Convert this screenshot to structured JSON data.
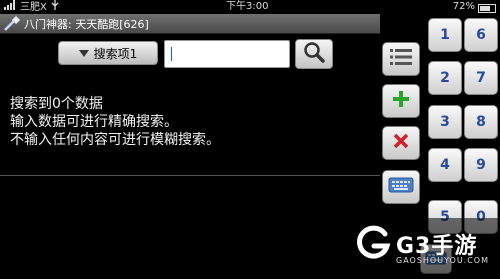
{
  "status": {
    "carrier": "三肥X",
    "time": "下午3:00",
    "battery_text": "72%",
    "battery_level": 72
  },
  "titlebar": {
    "title": "八门神器: 天天酷跑[626]"
  },
  "search": {
    "type_label": "搜索项1",
    "input_value": "",
    "button_icon": "magnifier-icon"
  },
  "result": {
    "line1": "搜索到0个数据",
    "line2": "输入数据可进行精确搜索。",
    "line3": "不输入任何内容可进行模糊搜索。"
  },
  "side_buttons": [
    {
      "icon": "list-icon"
    },
    {
      "icon": "plus-icon",
      "color": "#2aa52a"
    },
    {
      "icon": "close-icon",
      "color": "#d0202a"
    },
    {
      "icon": "keyboard-icon"
    },
    {
      "icon": "keyboard-icon"
    }
  ],
  "numpad": {
    "keys": [
      "1",
      "6",
      "2",
      "7",
      "3",
      "8",
      "4",
      "9",
      "5",
      "0"
    ]
  },
  "watermark": {
    "brand": "G3手游",
    "domain": "GAOSHOUYOU.COM"
  }
}
